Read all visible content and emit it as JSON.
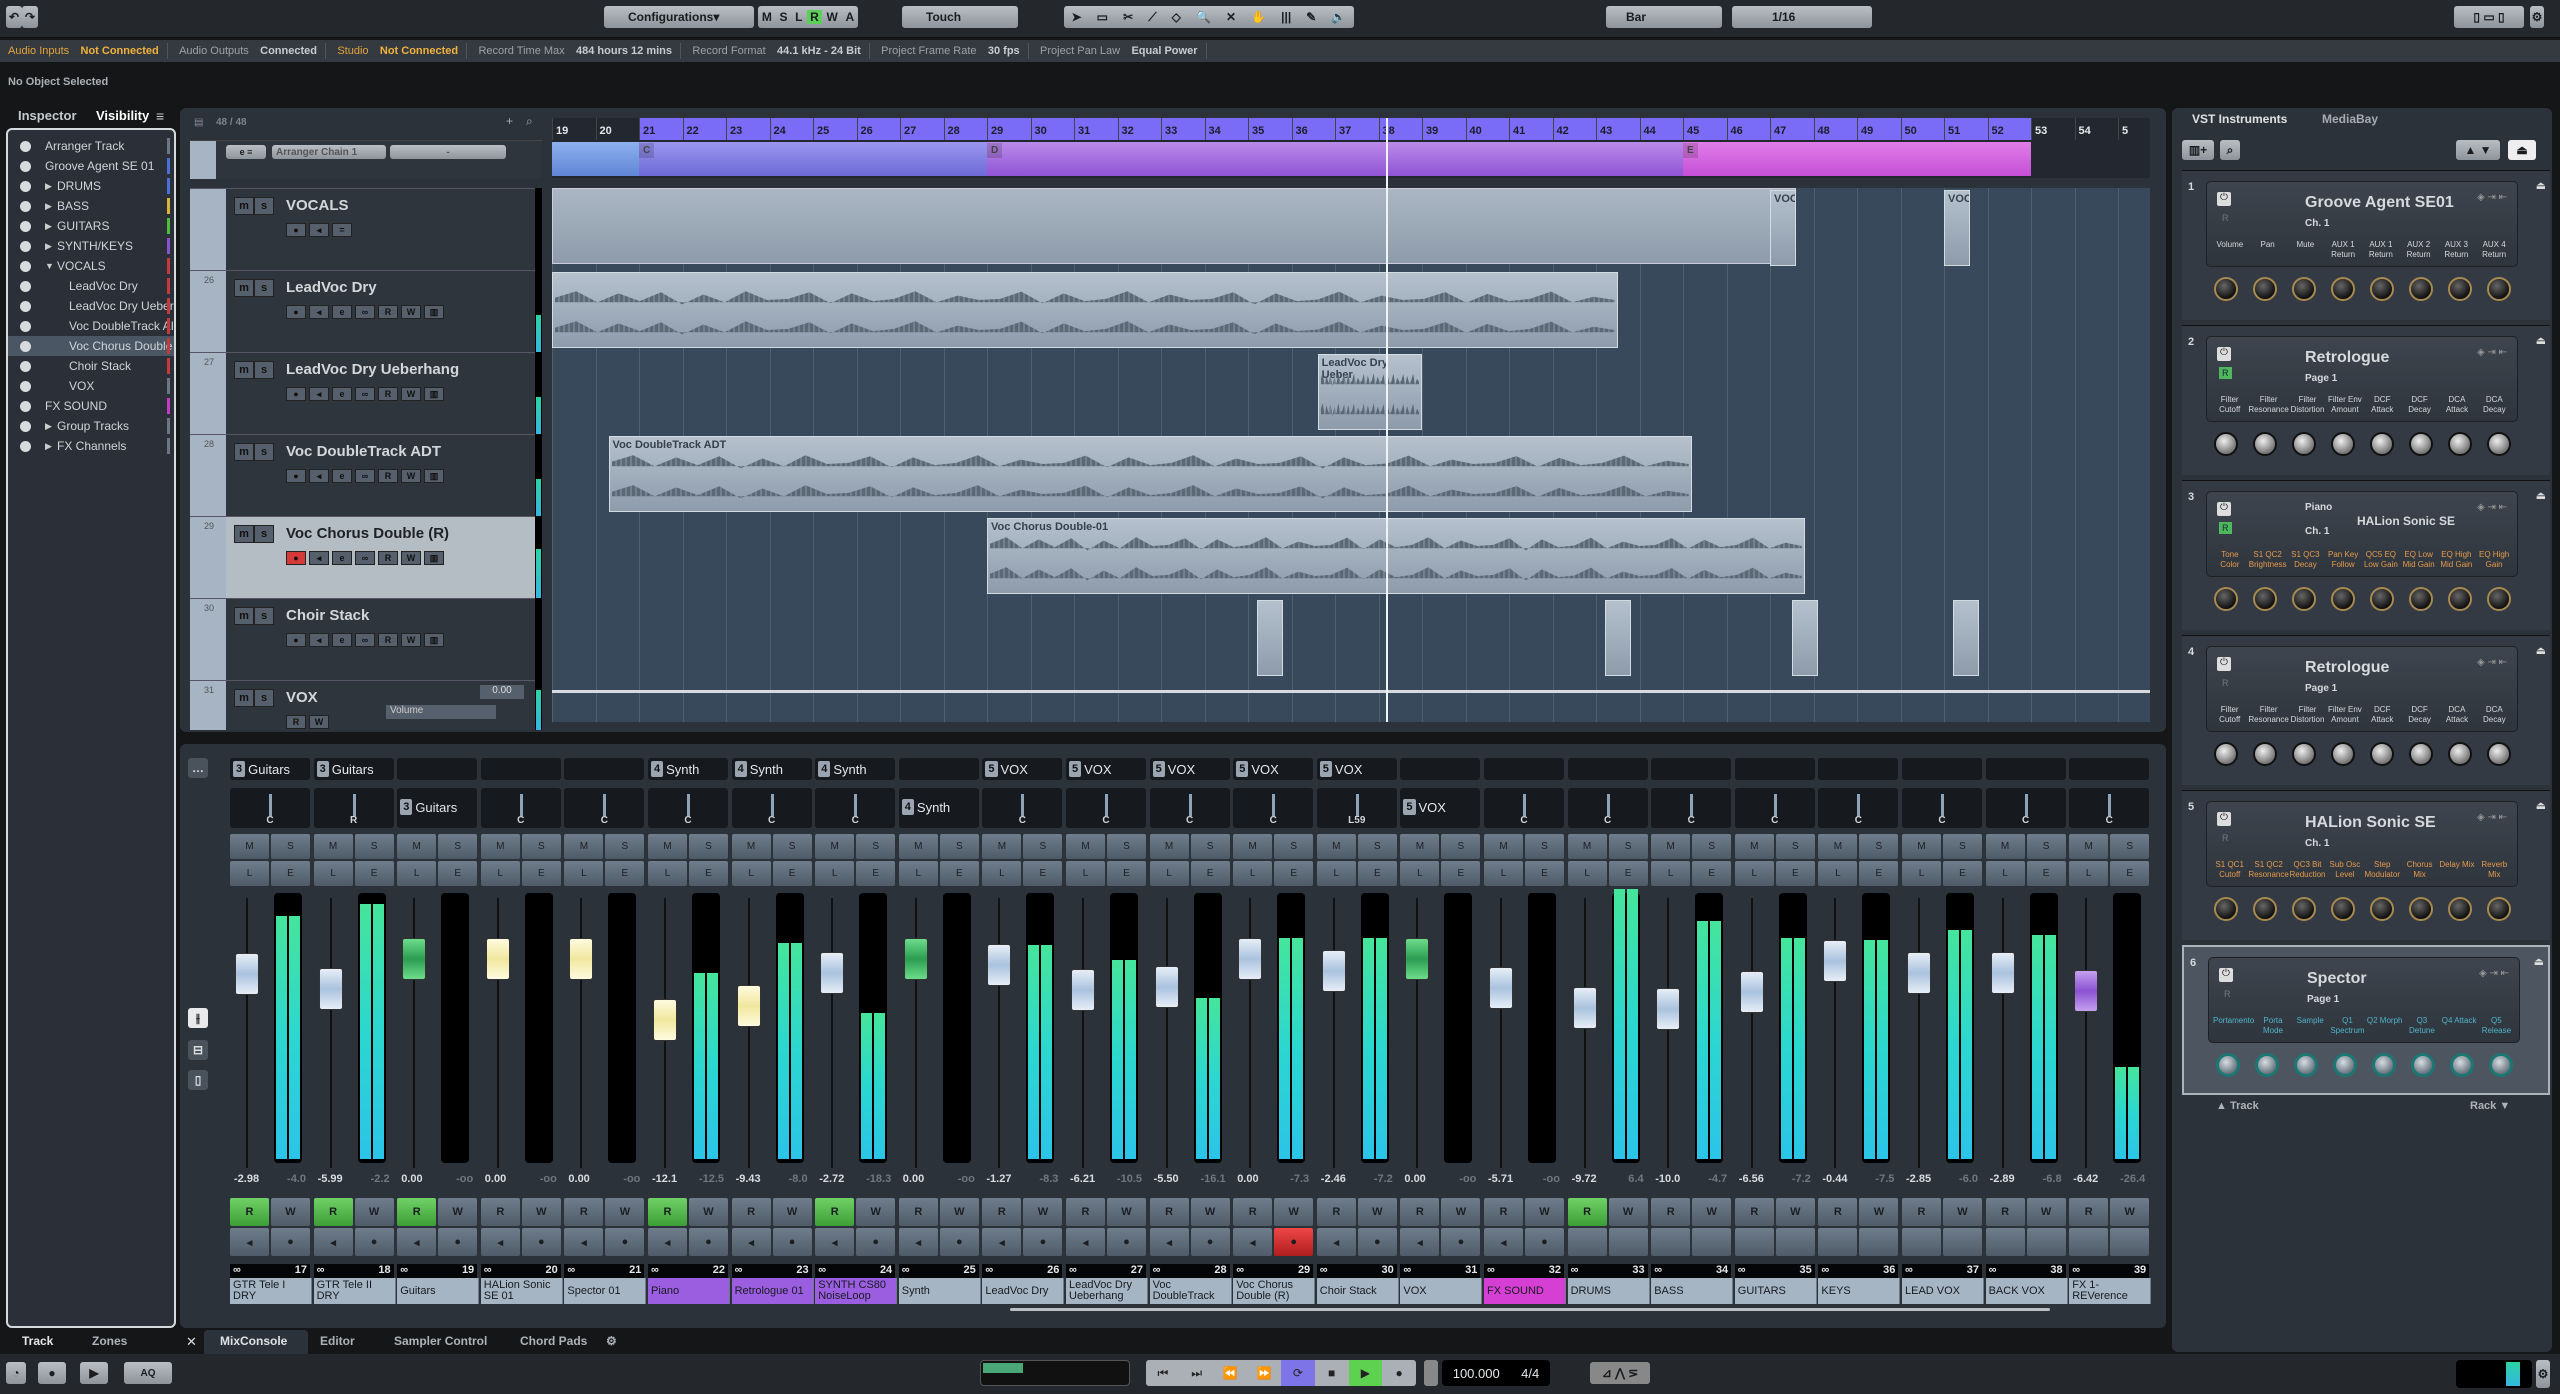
{
  "toolbar": {
    "configurations": "Configurations",
    "automation_modes": [
      "M",
      "S",
      "L",
      "R",
      "W",
      "A"
    ],
    "automation_mode_value": "Touch",
    "grid_type": "Bar",
    "quantize_value": "1/16"
  },
  "status": {
    "audio_inputs_label": "Audio Inputs",
    "audio_inputs_value": "Not Connected",
    "audio_outputs_label": "Audio Outputs",
    "audio_outputs_value": "Connected",
    "studio_label": "Studio",
    "studio_value": "Not Connected",
    "record_time_label": "Record Time Max",
    "record_time_value": "484 hours 12 mins",
    "record_format_label": "Record Format",
    "record_format_value": "44.1 kHz - 24 Bit",
    "frame_rate_label": "Project Frame Rate",
    "frame_rate_value": "30 fps",
    "pan_law_label": "Project Pan Law",
    "pan_law_value": "Equal Power"
  },
  "info_line": "No Object Selected",
  "left_zone": {
    "tabs": [
      "Inspector",
      "Visibility"
    ],
    "active_tab": "Visibility",
    "visibility_items": [
      {
        "label": "Arranger Track",
        "indent": 0,
        "color": "#6d7784"
      },
      {
        "label": "Groove Agent SE 01",
        "indent": 0,
        "color": "#4a6fd0"
      },
      {
        "label": "DRUMS",
        "indent": 1,
        "expander": "right",
        "color": "#4a6fd0"
      },
      {
        "label": "BASS",
        "indent": 1,
        "expander": "right",
        "color": "#d8b43a"
      },
      {
        "label": "GUITARS",
        "indent": 1,
        "expander": "right",
        "color": "#4bbf3c"
      },
      {
        "label": "SYNTH/KEYS",
        "indent": 1,
        "expander": "right",
        "color": "#8b52d0"
      },
      {
        "label": "VOCALS",
        "indent": 1,
        "expander": "down",
        "color": "#c23a3a"
      },
      {
        "label": "LeadVoc Dry",
        "indent": 2,
        "color": "#c23a3a"
      },
      {
        "label": "LeadVoc Dry Ueber",
        "indent": 2,
        "color": "#c23a3a"
      },
      {
        "label": "Voc DoubleTrack AI",
        "indent": 2,
        "color": "#c23a3a"
      },
      {
        "label": "Voc Chorus Double",
        "indent": 2,
        "color": "#c23a3a",
        "selected": true
      },
      {
        "label": "Choir Stack",
        "indent": 2,
        "color": "#c23a3a"
      },
      {
        "label": "VOX",
        "indent": 2,
        "color": "#6d7784"
      },
      {
        "label": "FX SOUND",
        "indent": 0,
        "color": "#c43ac7"
      },
      {
        "label": "Group Tracks",
        "indent": 1,
        "expander": "right",
        "color": "#6d7784"
      },
      {
        "label": "FX Channels",
        "indent": 1,
        "expander": "right",
        "color": "#6d7784"
      }
    ],
    "bottom_tabs": [
      "Track",
      "Zones"
    ]
  },
  "project": {
    "track_count": "48 / 48",
    "arranger_chain": "Arranger Chain 1",
    "arranger_chain_second": "-",
    "ruler_bars": [
      "19",
      "20",
      "21",
      "22",
      "23",
      "24",
      "25",
      "26",
      "27",
      "28",
      "29",
      "30",
      "31",
      "32",
      "33",
      "34",
      "35",
      "36",
      "37",
      "38",
      "39",
      "40",
      "41",
      "42",
      "43",
      "44",
      "45",
      "46",
      "47",
      "48",
      "49",
      "50",
      "51",
      "52",
      "53",
      "54",
      "5"
    ],
    "arranger_sections": [
      {
        "label": "C",
        "from_bar": 21,
        "to_bar": 29
      },
      {
        "label": "D",
        "from_bar": 29,
        "to_bar": 45
      },
      {
        "label": "E",
        "from_bar": 45,
        "to_bar": 53
      }
    ],
    "tracks": [
      {
        "num": "",
        "name": "VOCALS",
        "type": "folder"
      },
      {
        "num": "26",
        "name": "LeadVoc Dry"
      },
      {
        "num": "27",
        "name": "LeadVoc Dry Ueberhang"
      },
      {
        "num": "28",
        "name": "Voc DoubleTrack ADT"
      },
      {
        "num": "29",
        "name": "Voc Chorus Double (R)",
        "selected": true,
        "record": true
      },
      {
        "num": "30",
        "name": "Choir Stack"
      },
      {
        "num": "31",
        "name": "VOX",
        "type": "vca",
        "value": "0.00",
        "param": "Volume"
      }
    ],
    "track_buttons": {
      "mute": "m",
      "solo": "s",
      "read": "R",
      "write": "W"
    },
    "clips": [
      {
        "track": 1,
        "name": "",
        "from_bar": 19,
        "to_bar": 43.5
      },
      {
        "track": 2,
        "name": "LeadVoc Dry Ueber",
        "from_bar": 36.6,
        "to_bar": 39
      },
      {
        "track": 3,
        "name": "Voc DoubleTrack ADT",
        "from_bar": 20.3,
        "to_bar": 45.2
      },
      {
        "track": 4,
        "name": "Voc Chorus Double-01",
        "from_bar": 29,
        "to_bar": 47.8
      },
      {
        "track": 0,
        "name": "VOC",
        "from_bar": 47,
        "to_bar": 47.6
      },
      {
        "track": 0,
        "name": "VOC",
        "from_bar": 51,
        "to_bar": 51.6
      }
    ]
  },
  "mixer": {
    "channels": [
      {
        "num": "17",
        "name": "GTR Tele I DRY",
        "insert": "3 Guitars",
        "pan": "C",
        "fader": "-2.98",
        "peak": "-4.0",
        "read": true,
        "color": "#a6b5c4",
        "cap": "blue"
      },
      {
        "num": "18",
        "name": "GTR Tele II DRY",
        "insert": "3 Guitars",
        "pan": "R",
        "fader": "-5.99",
        "peak": "-2.2",
        "read": true,
        "color": "#a6b5c4",
        "cap": "blue"
      },
      {
        "num": "19",
        "name": "Guitars",
        "insert": "",
        "pan": "3 Guitars",
        "fader": "0.00",
        "peak": "-oo",
        "read": true,
        "color": "#a6b5c4",
        "cap": "grn"
      },
      {
        "num": "20",
        "name": "HALion Sonic SE 01",
        "insert": "",
        "pan": "C",
        "fader": "0.00",
        "peak": "-oo",
        "read": false,
        "color": "#a6b5c4",
        "cap": "yel"
      },
      {
        "num": "21",
        "name": "Spector 01",
        "insert": "",
        "pan": "C",
        "fader": "0.00",
        "peak": "-oo",
        "read": false,
        "color": "#a6b5c4",
        "cap": "yel"
      },
      {
        "num": "22",
        "name": "Piano",
        "insert": "4 Synth",
        "pan": "C",
        "fader": "-12.1",
        "peak": "-12.5",
        "read": true,
        "color": "#9b5ee0",
        "cap": "yel"
      },
      {
        "num": "23",
        "name": "Retrologue 01",
        "insert": "4 Synth",
        "pan": "C",
        "fader": "-9.43",
        "peak": "-8.0",
        "read": false,
        "color": "#9b5ee0",
        "cap": "yel"
      },
      {
        "num": "24",
        "name": "SYNTH CS80 NoiseLoop",
        "insert": "4 Synth",
        "pan": "C",
        "fader": "-2.72",
        "peak": "-18.3",
        "read": true,
        "color": "#9b5ee0",
        "cap": "blue"
      },
      {
        "num": "25",
        "name": "Synth",
        "insert": "",
        "pan": "4 Synth",
        "fader": "0.00",
        "peak": "-oo",
        "read": false,
        "color": "#a6b5c4",
        "cap": "grn"
      },
      {
        "num": "26",
        "name": "LeadVoc Dry",
        "insert": "5 VOX",
        "pan": "C",
        "fader": "-1.27",
        "peak": "-8.3",
        "read": false,
        "color": "#a6b5c4",
        "cap": "blue"
      },
      {
        "num": "27",
        "name": "LeadVoc Dry Ueberhang",
        "insert": "5 VOX",
        "pan": "C",
        "fader": "-6.21",
        "peak": "-10.5",
        "read": false,
        "color": "#a6b5c4",
        "cap": "blue"
      },
      {
        "num": "28",
        "name": "Voc DoubleTrack",
        "insert": "5 VOX",
        "pan": "C",
        "fader": "-5.50",
        "peak": "-16.1",
        "read": false,
        "color": "#a6b5c4",
        "cap": "blue"
      },
      {
        "num": "29",
        "name": "Voc Chorus Double (R)",
        "insert": "5 VOX",
        "pan": "C",
        "fader": "0.00",
        "peak": "-7.3",
        "read": false,
        "record": true,
        "color": "#a6b5c4",
        "cap": "blue"
      },
      {
        "num": "30",
        "name": "Choir Stack",
        "insert": "5 VOX",
        "pan": "L59",
        "fader": "-2.46",
        "peak": "-7.2",
        "read": false,
        "color": "#a6b5c4",
        "cap": "blue"
      },
      {
        "num": "31",
        "name": "VOX",
        "insert": "",
        "pan": "5 VOX",
        "fader": "0.00",
        "peak": "-oo",
        "read": false,
        "color": "#a6b5c4",
        "cap": "grn"
      },
      {
        "num": "32",
        "name": "FX SOUND",
        "insert": "",
        "pan": "C",
        "fader": "-5.71",
        "peak": "-oo",
        "read": false,
        "color": "#d63fd3",
        "cap": "blue"
      },
      {
        "num": "33",
        "name": "DRUMS",
        "insert": "",
        "pan": "C",
        "fader": "-9.72",
        "peak": "6.4",
        "read": true,
        "color": "#a6b5c4",
        "cap": "blue"
      },
      {
        "num": "34",
        "name": "BASS",
        "insert": "",
        "pan": "C",
        "fader": "-10.0",
        "peak": "-4.7",
        "read": false,
        "color": "#a6b5c4",
        "cap": "blue"
      },
      {
        "num": "35",
        "name": "GUITARS",
        "insert": "",
        "pan": "C",
        "fader": "-6.56",
        "peak": "-7.2",
        "read": false,
        "color": "#a6b5c4",
        "cap": "blue"
      },
      {
        "num": "36",
        "name": "KEYS",
        "insert": "",
        "pan": "C",
        "fader": "-0.44",
        "peak": "-7.5",
        "read": false,
        "color": "#a6b5c4",
        "cap": "blue"
      },
      {
        "num": "37",
        "name": "LEAD VOX",
        "insert": "",
        "pan": "C",
        "fader": "-2.85",
        "peak": "-6.0",
        "read": false,
        "color": "#a6b5c4",
        "cap": "blue"
      },
      {
        "num": "38",
        "name": "BACK VOX",
        "insert": "",
        "pan": "C",
        "fader": "-2.89",
        "peak": "-6.8",
        "read": false,
        "color": "#a6b5c4",
        "cap": "blue"
      },
      {
        "num": "39",
        "name": "FX 1-REVerence",
        "insert": "",
        "pan": "C",
        "fader": "-6.42",
        "peak": "-26.4",
        "read": false,
        "color": "#a6b5c4",
        "cap": "pur"
      }
    ],
    "button_labels": {
      "m": "M",
      "s": "S",
      "l": "L",
      "e": "E",
      "r": "R",
      "w": "W"
    }
  },
  "lower_zone_tabs": [
    "MixConsole",
    "Editor",
    "Sampler Control",
    "Chord Pads"
  ],
  "lower_zone_active": "MixConsole",
  "vsti": {
    "tabs": [
      "VST Instruments",
      "MediaBay"
    ],
    "racks": [
      {
        "slot": "1",
        "name": "Groove Agent SE01",
        "sub": "Ch. 1",
        "labels": [
          "Volume",
          "Pan",
          "Mute",
          "AUX 1 Return",
          "AUX 1 Return",
          "AUX 2 Return",
          "AUX 3 Return",
          "AUX 4 Return"
        ],
        "label_color": "#d6d9dd",
        "knob": "gold"
      },
      {
        "slot": "2",
        "name": "Retrologue",
        "sub": "Page 1",
        "labels": [
          "Filter Cutoff",
          "Filter Resonance",
          "Filter Distortion",
          "Filter Env Amount",
          "DCF Attack",
          "DCF Decay",
          "DCA Attack",
          "DCA Decay"
        ],
        "label_color": "#d6d9dd",
        "knob": "silver",
        "read": true
      },
      {
        "slot": "3",
        "name": "HALion Sonic SE",
        "sub": "Ch. 1",
        "program": "Piano",
        "labels": [
          "Tone Color",
          "S1 QC2 Brightness",
          "S1 QC3 Decay",
          "Pan Key Follow",
          "QC5 EQ Low Gain",
          "EQ Low Mid Gain",
          "EQ High Mid Gain",
          "EQ High Gain"
        ],
        "label_color": "#e59a4b",
        "knob": "gold",
        "read": true
      },
      {
        "slot": "4",
        "name": "Retrologue",
        "sub": "Page 1",
        "labels": [
          "Filter Cutoff",
          "Filter Resonance",
          "Filter Distortion",
          "Filter Env Amount",
          "DCF Attack",
          "DCF Decay",
          "DCA Attack",
          "DCA Decay"
        ],
        "label_color": "#d6d9dd",
        "knob": "silver"
      },
      {
        "slot": "5",
        "name": "HALion Sonic SE",
        "sub": "Ch. 1",
        "labels": [
          "S1 QC1 Cutoff",
          "S1 QC2 Resonance",
          "QC3 Bit Reduction",
          "Sub Osc Level",
          "Step Modulator",
          "Chorus Mix",
          "Delay Mix",
          "Reverb Mix"
        ],
        "label_color": "#e59a4b",
        "knob": "gold"
      },
      {
        "slot": "6",
        "name": "Spector",
        "sub": "Page 1",
        "labels": [
          "Portamento",
          "Porta Mode",
          "Sample",
          "Q1 Spectrum",
          "Q2 Morph",
          "Q3 Detune",
          "Q4 Attack",
          "Q5 Release"
        ],
        "label_color": "#4fb4c8",
        "knob": "teal",
        "selected": true
      }
    ],
    "footer_track": "Track",
    "footer_rack": "Rack"
  },
  "transport": {
    "tempo": "100.000",
    "signature": "4/4",
    "aq_label": "AQ"
  }
}
